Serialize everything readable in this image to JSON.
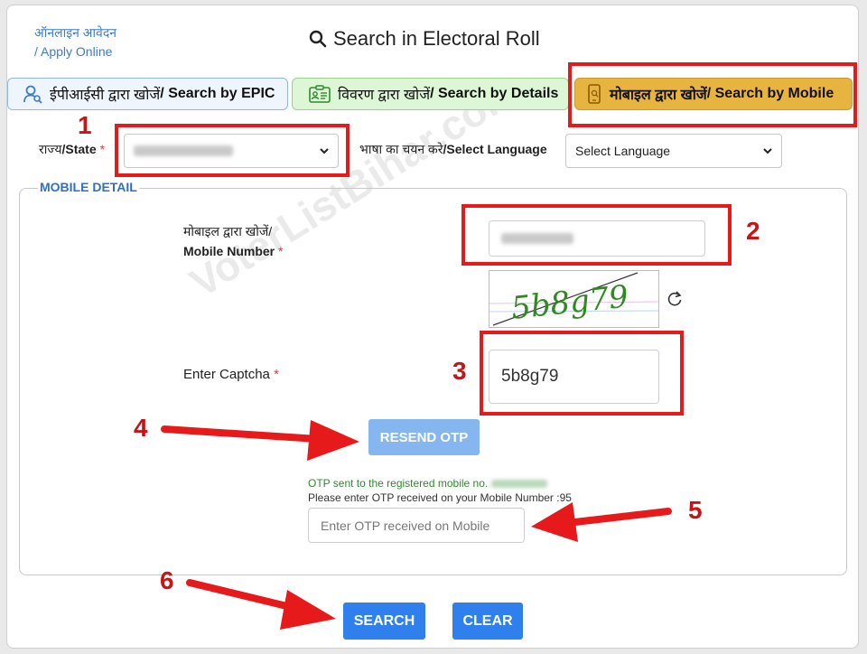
{
  "header": {
    "apply_hindi": "ऑनलाइन आवेदन",
    "apply_english": "/ Apply Online",
    "title": "Search in Electoral Roll"
  },
  "tabs": [
    {
      "hindi": "ईपीआईसी द्वारा खोजें",
      "english": " / Search by EPIC",
      "icon": "user-search-icon"
    },
    {
      "hindi": "विवरण द्वारा खोजें",
      "english": "/ Search by Details",
      "icon": "id-card-icon"
    },
    {
      "hindi": "मोबाइल द्वारा खोजें",
      "english": " / Search by Mobile",
      "icon": "mobile-phone-icon",
      "active": true
    }
  ],
  "form": {
    "state_label_hi": "राज्य",
    "state_label_en": "/State",
    "required_mark": "*",
    "language_label_hi": "भाषा का चयन करे",
    "language_label_en": "/Select Language",
    "language_value": "Select Language",
    "section_title": "MOBILE DETAIL",
    "mobile_label_hi": "मोबाइल द्वारा खोजें/",
    "mobile_label_en": "Mobile Number",
    "captcha_label": "Enter Captcha",
    "captcha_image_text": "5b8g79",
    "captcha_value": "5b8g79",
    "resend_otp": "RESEND OTP",
    "otp_sent": "OTP sent to the registered mobile no.",
    "otp_prompt": "Please enter OTP received on your Mobile Number :95",
    "otp_placeholder": "Enter OTP received on Mobile",
    "search": "SEARCH",
    "clear": "CLEAR"
  },
  "annotations": {
    "steps": [
      "1",
      "2",
      "3",
      "4",
      "5",
      "6"
    ],
    "watermark": "VoterListBihar.com"
  },
  "colors": {
    "accent_blue": "#2f80ed",
    "disabled_blue": "#85b6f0",
    "annotation_red": "#e61a1a",
    "active_tab": "#e8b440",
    "otp_green": "#2e8b2e"
  }
}
